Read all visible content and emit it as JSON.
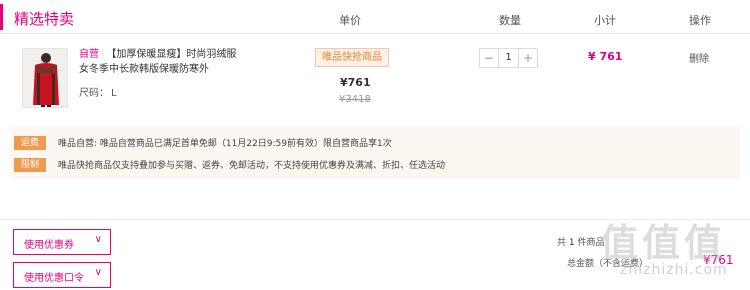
{
  "header": {
    "section_title": "精选特卖",
    "col_price": "单价",
    "col_quantity": "数量",
    "col_subtotal": "小计",
    "col_operation": "操作"
  },
  "product": {
    "self_tag": "自营",
    "name": "【加厚保暖显瘦】时尚羽绒服女冬季中长款韩版保暖防寒外",
    "size_label": "尺码：",
    "size_value": "L",
    "badge": "唯品快抢商品",
    "price_now": "¥761",
    "price_orig": "¥3418",
    "quantity": "1",
    "qty_minus": "−",
    "qty_plus": "+",
    "subtotal": "¥ 761",
    "delete": "删除"
  },
  "promos": [
    {
      "tag": "运费",
      "text": "唯品自营: 唯品自营商品已满足首单免邮（11月22日9:59前有效）限自营商品享1次"
    },
    {
      "tag": "限制",
      "text": "唯品快抢商品仅支持叠加参与买赠、返券、免邮活动，不支持使用优惠券及满减、折扣、任选活动"
    }
  ],
  "coupons": {
    "coupon_btn": "使用优惠券",
    "code_btn": "使用优惠口令",
    "chevron": "∨"
  },
  "summary": {
    "prefix": "共",
    "count": "1",
    "suffix": "件商品",
    "total_label": "总金额（不含运费）",
    "total_amount": "¥761"
  },
  "watermark": {
    "glyphs": "值值值",
    "text": "zhizhizhi.com"
  },
  "colors": {
    "accent": "#e4007f",
    "promo_tag": "#f09a51",
    "promo_bg": "#fdf7f1"
  }
}
